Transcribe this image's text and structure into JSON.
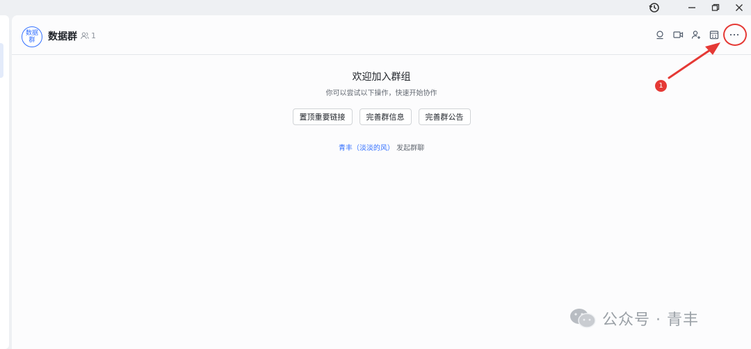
{
  "window": {
    "history_icon": "history-icon",
    "minimize_icon": "minimize-icon",
    "restore_icon": "restore-icon",
    "close_icon": "close-icon"
  },
  "chat_header": {
    "avatar_text": "数据群",
    "group_name": "数据群",
    "member_count": "1",
    "icons": [
      "search-icon",
      "video-icon",
      "add-member-icon",
      "calendar-icon",
      "more-icon"
    ]
  },
  "welcome": {
    "title": "欢迎加入群组",
    "subtitle": "你可以尝试以下操作，快速开始协作",
    "buttons": [
      "置顶重要链接",
      "完善群信息",
      "完善群公告"
    ],
    "creator_link": "青丰（淡淡的风）",
    "creator_action": "发起群聊"
  },
  "annotation": {
    "badge": "1",
    "color": "#e53935"
  },
  "watermark": {
    "text": "公众号 · 青丰"
  },
  "colors": {
    "accent": "#3370ff",
    "background": "#fcfcfd"
  }
}
